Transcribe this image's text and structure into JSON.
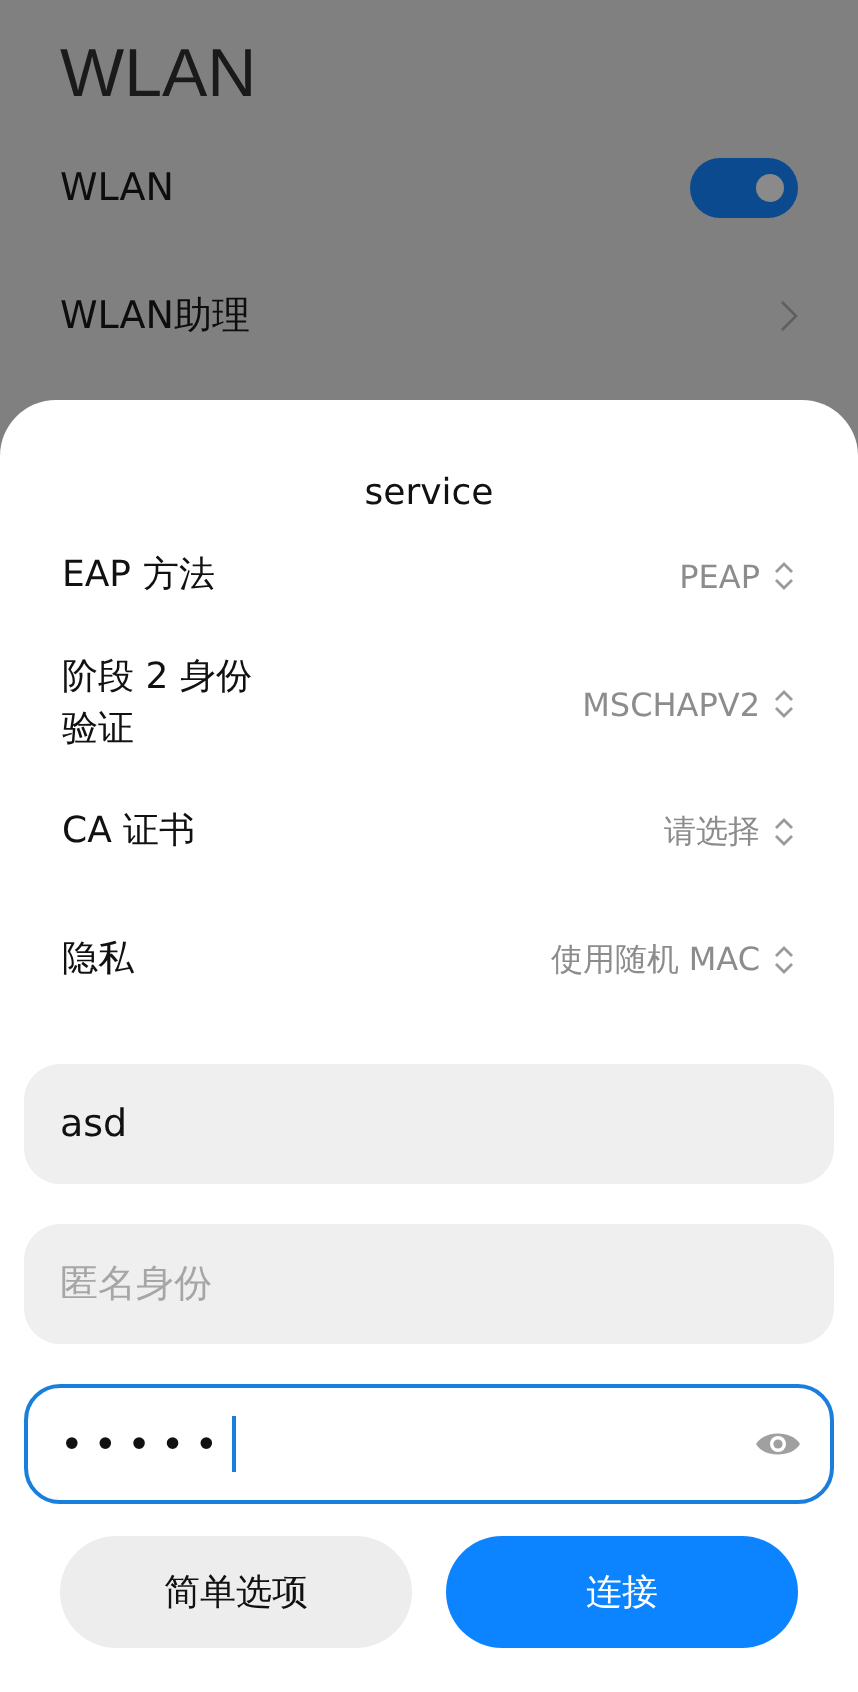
{
  "page": {
    "title": "WLAN",
    "settings": [
      {
        "kind": "switch",
        "label": "WLAN",
        "on": true
      },
      {
        "kind": "link",
        "label": "WLAN助理"
      }
    ]
  },
  "sheet": {
    "heading": "service",
    "options": [
      {
        "label": "EAP 方法",
        "value": "PEAP"
      },
      {
        "label": "阶段 2 身份验证",
        "value": "MSCHAPV2"
      },
      {
        "label": "CA 证书",
        "value": "请选择"
      },
      {
        "label": "隐私",
        "value": "使用随机 MAC"
      }
    ],
    "fields": [
      {
        "kind": "text",
        "value": "asd",
        "focused": false
      },
      {
        "kind": "text",
        "placeholder": "匿名身份",
        "focused": false
      },
      {
        "kind": "password",
        "value": "•••••",
        "focused": true
      }
    ],
    "buttons": [
      {
        "label": "简单选项",
        "primary": false
      },
      {
        "label": "连接",
        "primary": true
      }
    ]
  }
}
